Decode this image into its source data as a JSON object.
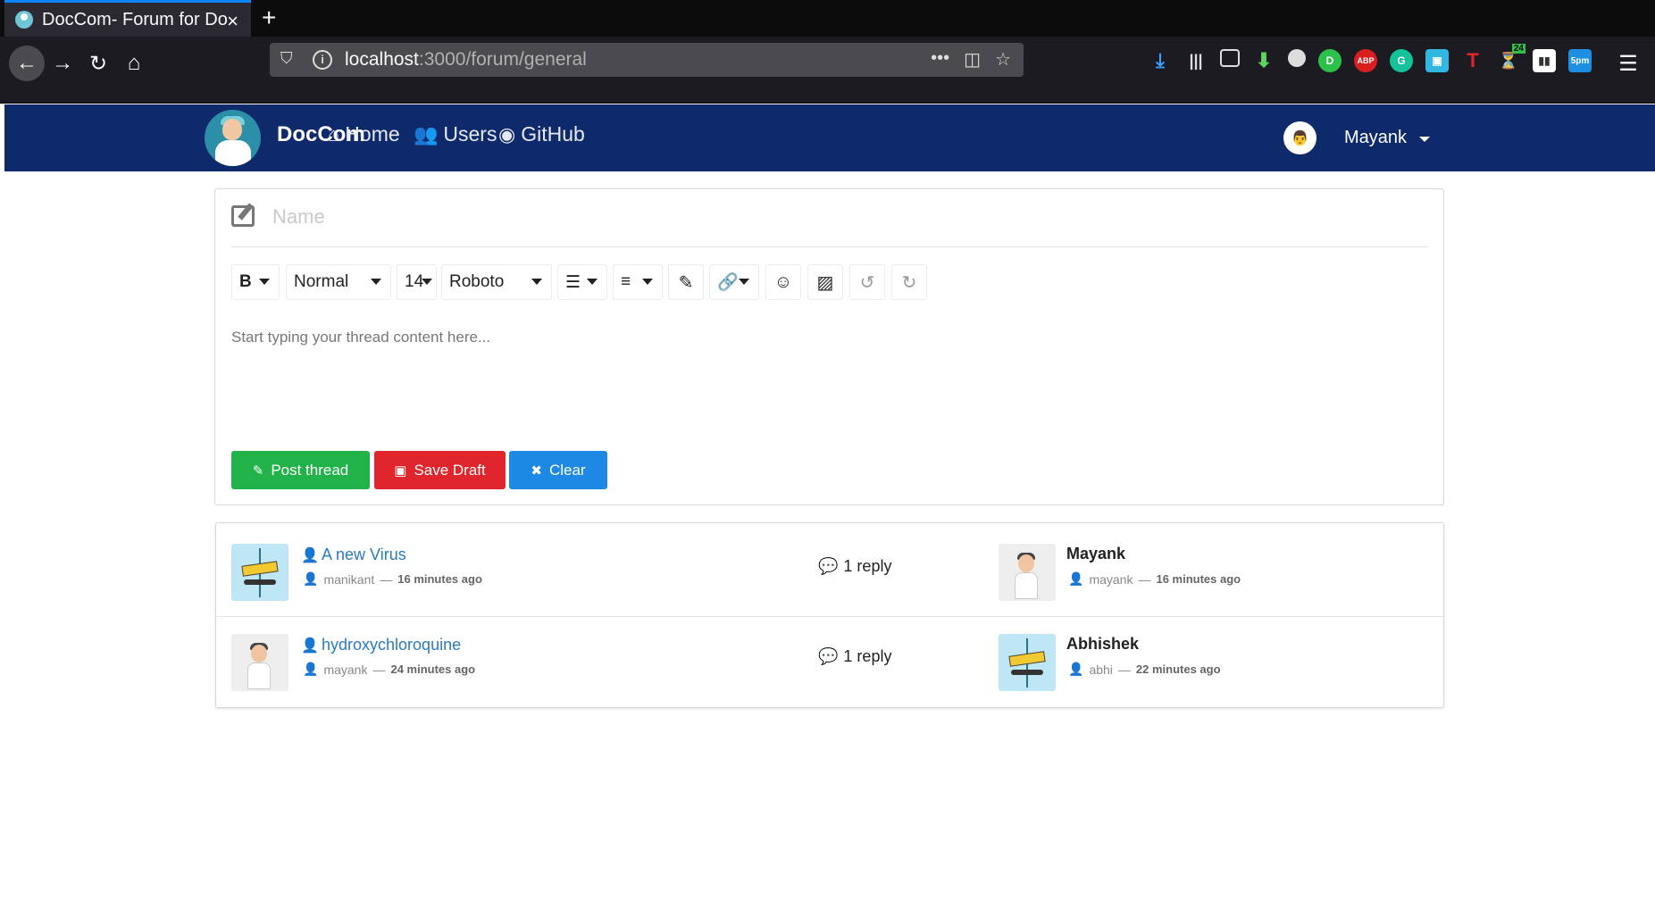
{
  "browser": {
    "tab_title": "DocCom- Forum for Do",
    "url_host": "localhost",
    "url_path": ":3000/forum/general",
    "ext_badge_count": "24",
    "ext_badge_time": "5pm",
    "ext_abp": "ABP"
  },
  "header": {
    "brand": "DocCom",
    "nav": [
      {
        "label": "Home",
        "icon": "home-icon"
      },
      {
        "label": "Users",
        "icon": "users-icon"
      },
      {
        "label": "GitHub",
        "icon": "github-icon"
      }
    ],
    "user": "Mayank"
  },
  "editor": {
    "name_placeholder": "Name",
    "toolbar": {
      "bold": "B",
      "paragraph": "Normal",
      "font_size": "14",
      "font_family": "Roboto"
    },
    "content_placeholder": "Start typing your thread content here...",
    "buttons": {
      "post": "Post thread",
      "draft": "Save Draft",
      "clear": "Clear"
    }
  },
  "threads": [
    {
      "title": "A new Virus",
      "author": "manikant",
      "ago": "16 minutes ago",
      "replies": "1 reply",
      "last_name": "Mayank",
      "last_user": "mayank",
      "last_ago": "16 minutes ago"
    },
    {
      "title": "hydroxychloroquine",
      "author": "mayank",
      "ago": "24 minutes ago",
      "replies": "1 reply",
      "last_name": "Abhishek",
      "last_user": "abhi",
      "last_ago": "22 minutes ago"
    }
  ],
  "colors": {
    "header_bg": "#0e2a6b",
    "post_btn": "#21b34a",
    "draft_btn": "#e0262c",
    "clear_btn": "#1e88e5",
    "link": "#2a7bbf"
  }
}
